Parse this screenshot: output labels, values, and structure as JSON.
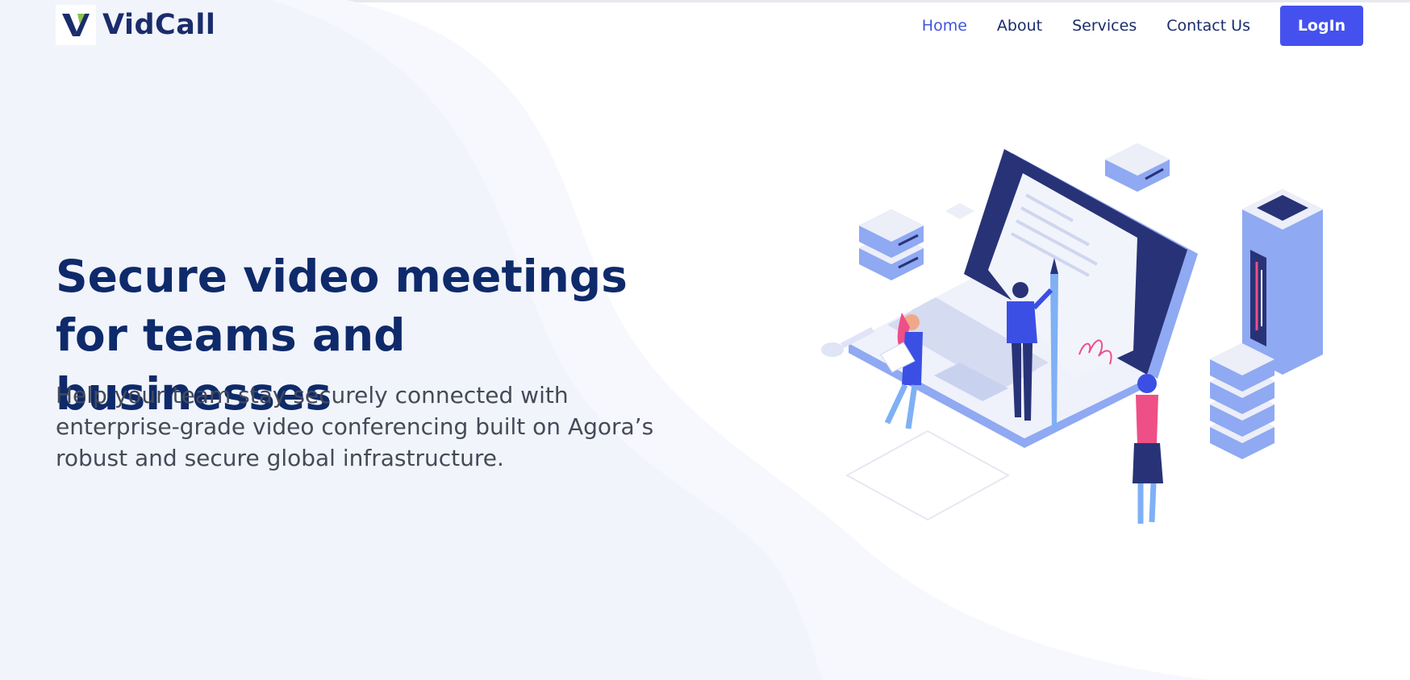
{
  "brand": {
    "name": "VidCall",
    "logo_icon": "v-logo-icon",
    "colors": {
      "primary": "#4451ee",
      "navy": "#1b2c6b",
      "green": "#8bc34a"
    }
  },
  "nav": {
    "items": [
      {
        "label": "Home",
        "active": true
      },
      {
        "label": "About",
        "active": false
      },
      {
        "label": "Services",
        "active": false
      },
      {
        "label": "Contact Us",
        "active": false
      }
    ],
    "login_label": "LogIn"
  },
  "hero": {
    "title": "Secure video meetings for teams and businesses",
    "subtitle": "Help your team stay securely connected with enterprise-grade video conferencing built on Agora’s robust and secure global infrastructure.",
    "illustration": "laptop-contract-signing-illustration"
  }
}
